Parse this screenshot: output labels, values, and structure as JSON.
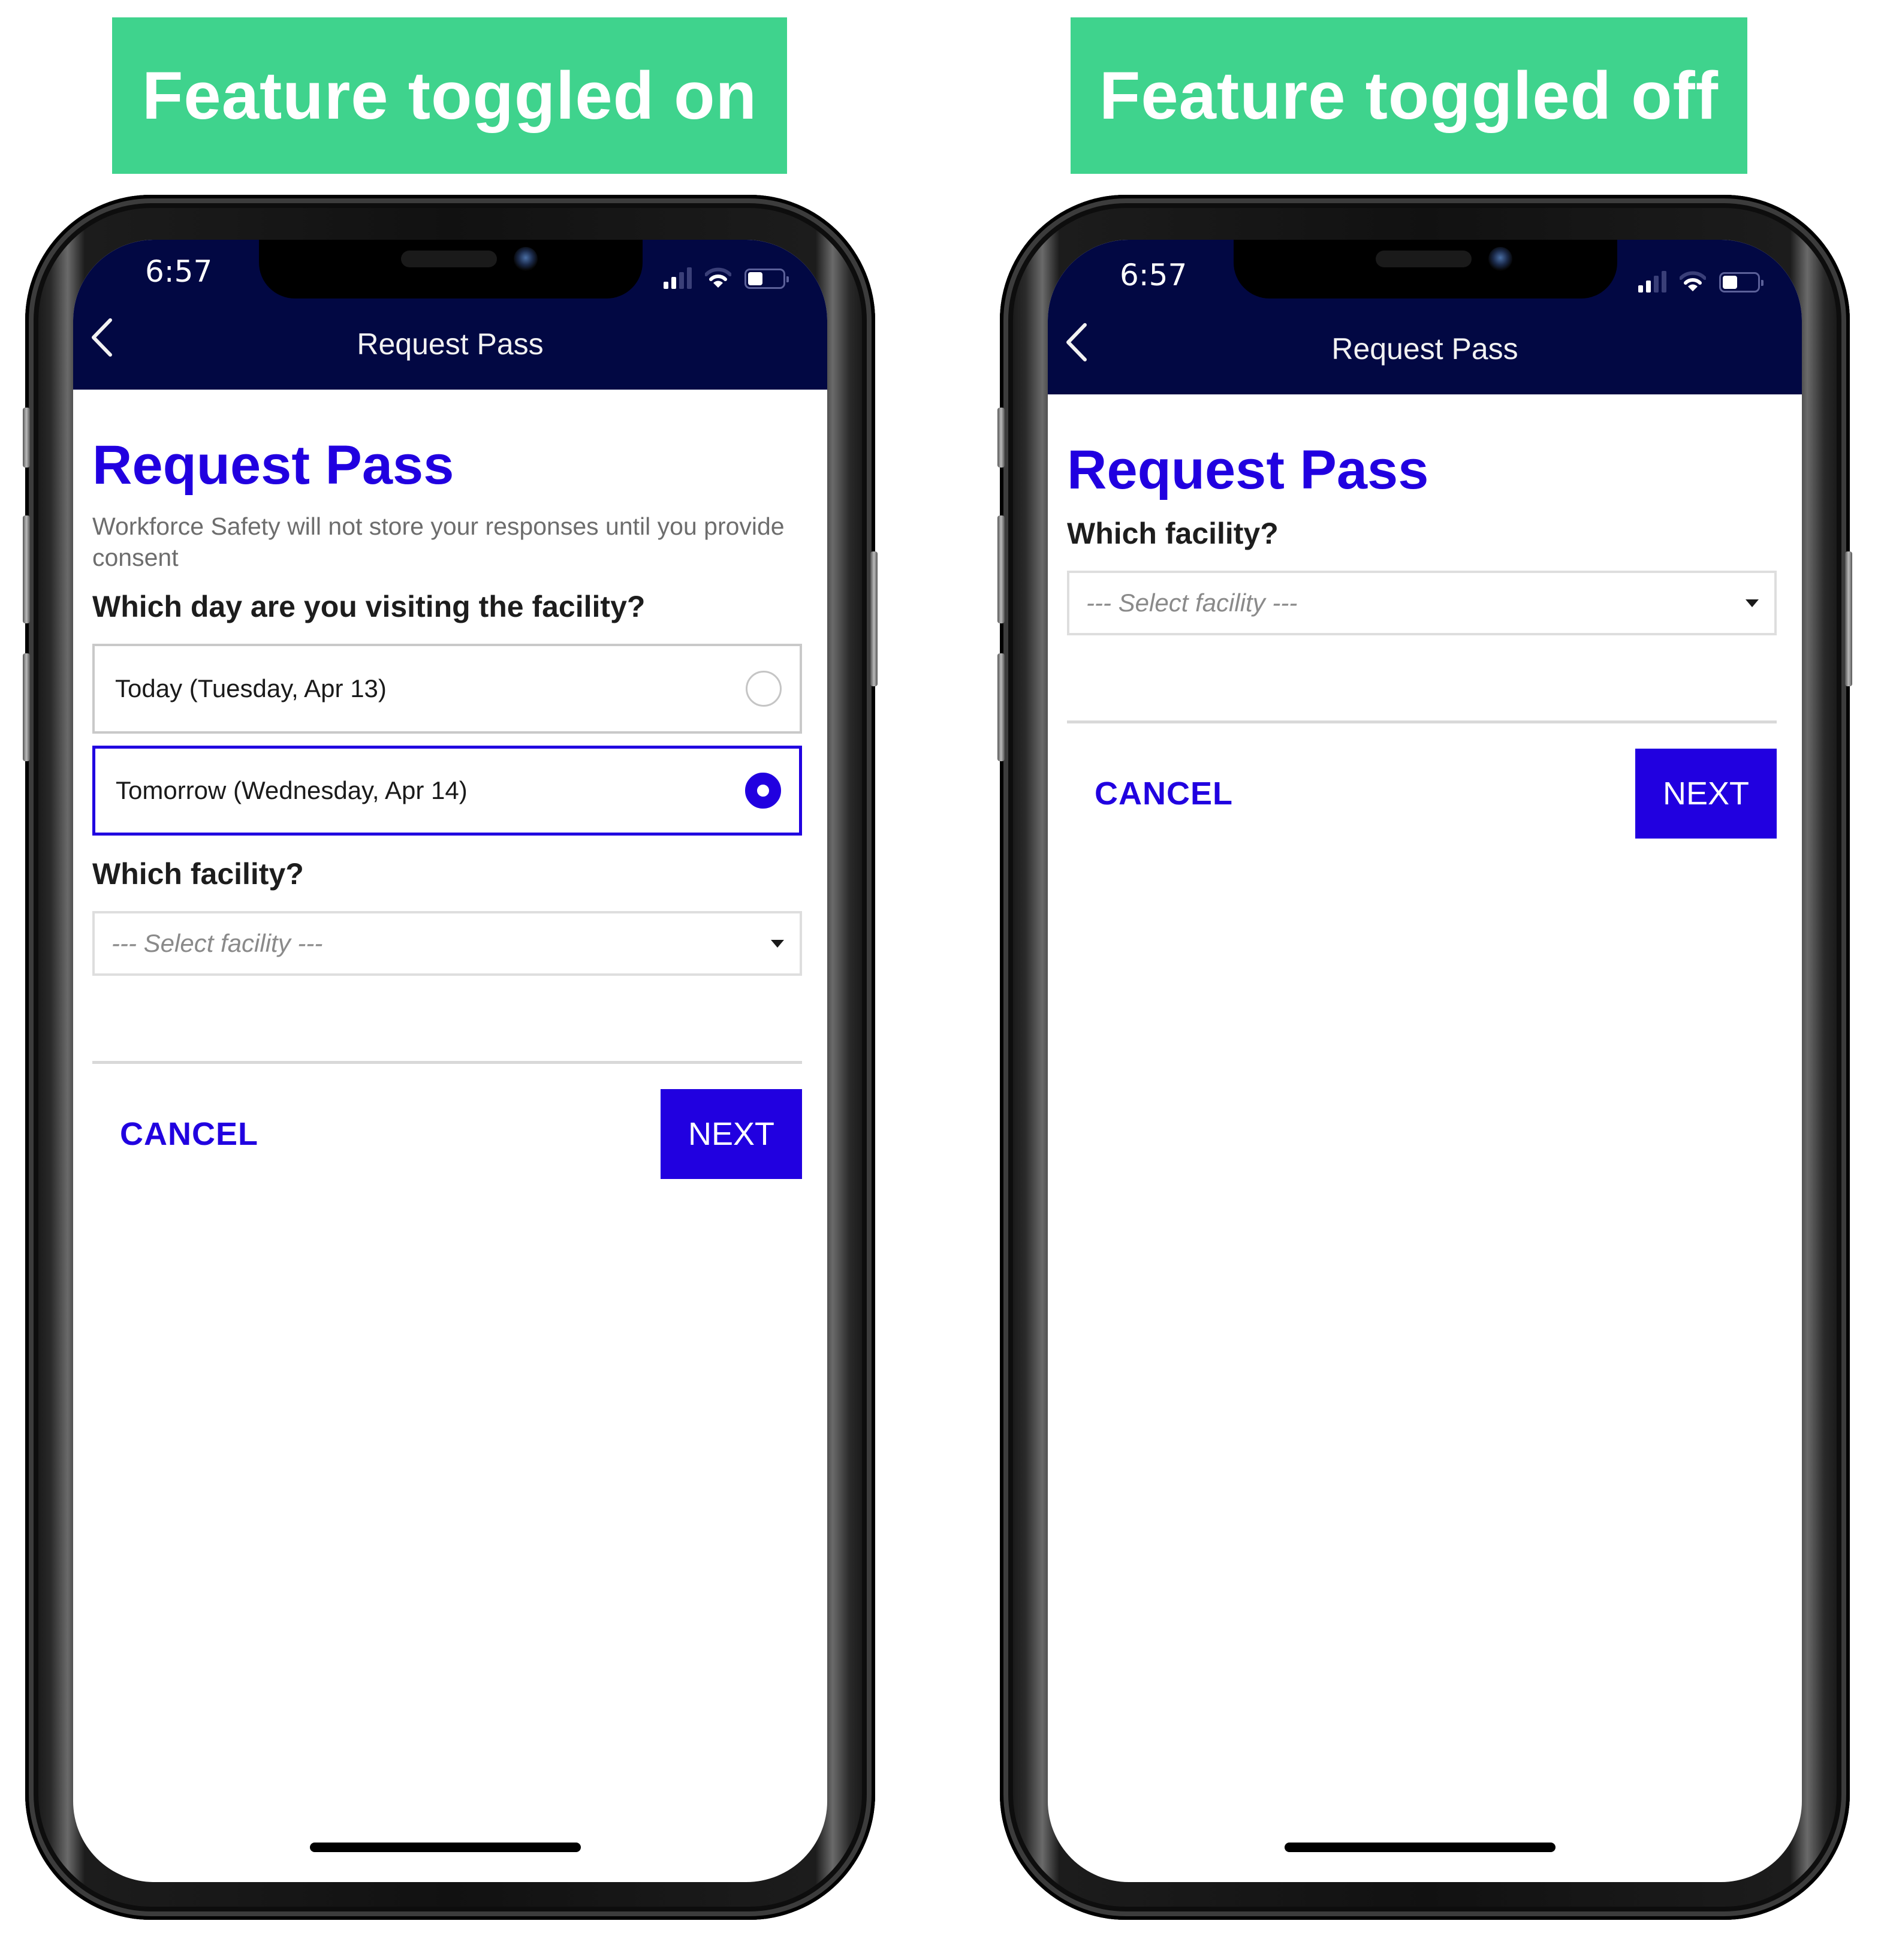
{
  "banners": {
    "left": "Feature toggled on",
    "right": "Feature toggled off"
  },
  "colors": {
    "banner_green": "#3fd38d",
    "navbar_navy": "#020843",
    "accent_blue": "#2100e0"
  },
  "phones": [
    {
      "state": "feature-on",
      "status_bar": {
        "time": "6:57",
        "signal_bars": 2,
        "signal_max": 4,
        "wifi": true,
        "battery_level": 0.35
      },
      "navbar": {
        "title": "Request Pass",
        "back_icon": "chevron-left-icon"
      },
      "page_title": "Request Pass",
      "disclaimer": "Workforce Safety will not store your responses until you provide consent",
      "day_question": "Which day are you visiting the facility?",
      "day_options": [
        {
          "label": "Today (Tuesday, Apr 13)",
          "selected": false
        },
        {
          "label": "Tomorrow (Wednesday, Apr 14)",
          "selected": true
        }
      ],
      "facility_question": "Which facility?",
      "facility_select": {
        "placeholder": "--- Select facility ---",
        "value": ""
      },
      "cancel_label": "CANCEL",
      "next_label": "NEXT"
    },
    {
      "state": "feature-off",
      "status_bar": {
        "time": "6:57",
        "signal_bars": 2,
        "signal_max": 4,
        "wifi": true,
        "battery_level": 0.35
      },
      "navbar": {
        "title": "Request Pass",
        "back_icon": "chevron-left-icon"
      },
      "page_title": "Request Pass",
      "facility_question": "Which facility?",
      "facility_select": {
        "placeholder": "--- Select facility ---",
        "value": ""
      },
      "cancel_label": "CANCEL",
      "next_label": "NEXT"
    }
  ]
}
